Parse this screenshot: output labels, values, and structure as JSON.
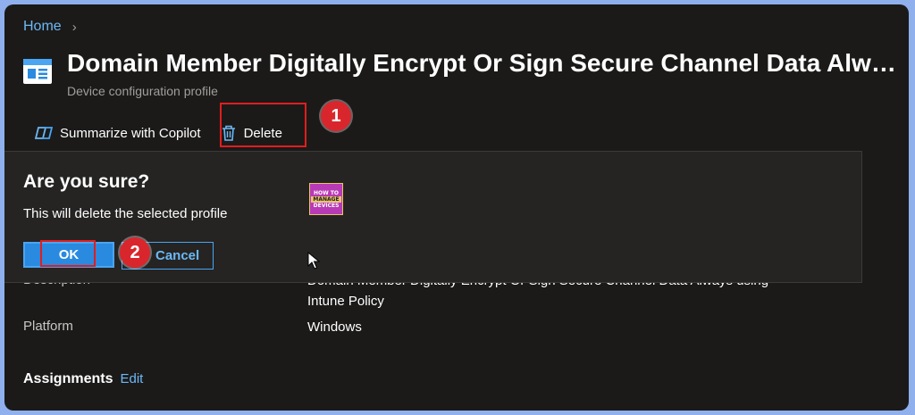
{
  "breadcrumb": {
    "home": "Home",
    "separator": "›"
  },
  "header": {
    "title": "Domain Member Digitally Encrypt Or Sign Secure Channel Data Always using Intune Policy",
    "subtitle": "Device configuration profile"
  },
  "toolbar": {
    "copilot_label": "Summarize with Copilot",
    "delete_label": "Delete"
  },
  "annotations": {
    "badge1": "1",
    "badge2": "2"
  },
  "dialog": {
    "title": "Are you sure?",
    "message": "This will delete the selected profile",
    "ok_label": "OK",
    "cancel_label": "Cancel",
    "logo_lines": [
      "HOW TO",
      "MANAGE",
      "DEVICES"
    ]
  },
  "details": {
    "description_label": "Description",
    "description_value_line1": "Domain Member Digitally Encrypt Or Sign Secure Channel Data Always using",
    "description_value_line2": "Intune Policy",
    "platform_label": "Platform",
    "platform_value": "Windows"
  },
  "assignments": {
    "label": "Assignments",
    "edit_label": "Edit"
  },
  "colors": {
    "background": "#1b1a19",
    "accent": "#2a8ae0",
    "link": "#6cb8f6",
    "highlight": "#e01e1e",
    "badge": "#d9262c"
  }
}
